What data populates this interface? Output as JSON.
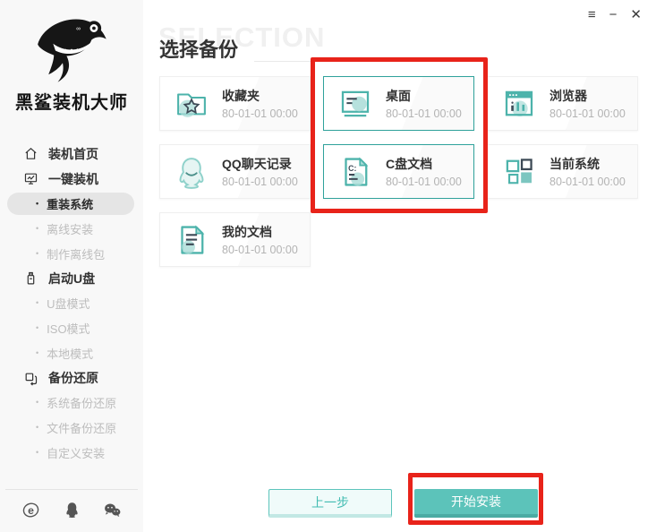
{
  "window_controls": [
    {
      "name": "menu-icon",
      "glyph": "≡"
    },
    {
      "name": "minimize-icon",
      "glyph": "−"
    },
    {
      "name": "close-icon",
      "glyph": "✕"
    }
  ],
  "sidebar": {
    "brand_name": "黑鲨装机大师",
    "menu": [
      {
        "label": "装机首页",
        "type": "top",
        "icon": "home-icon",
        "active": false
      },
      {
        "label": "一键装机",
        "type": "top",
        "icon": "monitor-icon",
        "active": false
      },
      {
        "label": "重装系统",
        "type": "sub",
        "active": true
      },
      {
        "label": "离线安装",
        "type": "sub",
        "active": false
      },
      {
        "label": "制作离线包",
        "type": "sub",
        "active": false
      },
      {
        "label": "启动U盘",
        "type": "top",
        "icon": "usb-icon",
        "active": false
      },
      {
        "label": "U盘模式",
        "type": "sub",
        "active": false
      },
      {
        "label": "ISO模式",
        "type": "sub",
        "active": false
      },
      {
        "label": "本地模式",
        "type": "sub",
        "active": false
      },
      {
        "label": "备份还原",
        "type": "top",
        "icon": "restore-icon",
        "active": false
      },
      {
        "label": "系统备份还原",
        "type": "sub",
        "active": false
      },
      {
        "label": "文件备份还原",
        "type": "sub",
        "active": false
      },
      {
        "label": "自定义安装",
        "type": "sub",
        "active": false
      }
    ],
    "footer_icons": [
      {
        "name": "ie-icon"
      },
      {
        "name": "qq-icon"
      },
      {
        "name": "wechat-icon"
      }
    ]
  },
  "main": {
    "watermark": "SELECTION",
    "title": "选择备份",
    "cards": [
      {
        "label": "收藏夹",
        "time": "80-01-01 00:00",
        "icon": "favorites-folder-icon",
        "selected": false
      },
      {
        "label": "桌面",
        "time": "80-01-01 00:00",
        "icon": "desktop-icon",
        "selected": true
      },
      {
        "label": "浏览器",
        "time": "80-01-01 00:00",
        "icon": "browser-icon",
        "selected": false
      },
      {
        "label": "QQ聊天记录",
        "time": "80-01-01 00:00",
        "icon": "qq-chat-icon",
        "selected": false
      },
      {
        "label": "C盘文档",
        "time": "80-01-01 00:00",
        "icon": "c-drive-doc-icon",
        "selected": true
      },
      {
        "label": "当前系统",
        "time": "80-01-01 00:00",
        "icon": "current-system-icon",
        "selected": false
      },
      {
        "label": "我的文档",
        "time": "80-01-01 00:00",
        "icon": "my-documents-icon",
        "selected": false
      }
    ],
    "buttons": {
      "prev": "上一步",
      "start": "开始安装"
    },
    "colors": {
      "accent": "#52bdb4",
      "selected_border": "#2fa29b",
      "annotation_red": "#e8231a"
    }
  }
}
